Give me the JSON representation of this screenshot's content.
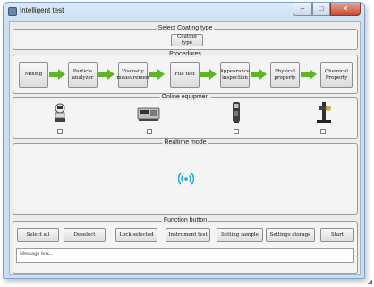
{
  "window": {
    "title": "Intelligent test",
    "controls": {
      "minimize": "‒",
      "maximize": "□",
      "close": "✕"
    }
  },
  "coating": {
    "group_title": "Select Coating type",
    "button": "Coating type"
  },
  "procedures": {
    "group_title": "Procedures",
    "steps": [
      "Mixing",
      "Particle analyzer",
      "Viscosity measuremen",
      "File test",
      "Appearance inspection",
      "Physical property",
      "Chemical Property"
    ]
  },
  "equipment": {
    "group_title": "Online equipmen",
    "items": [
      "robot-device",
      "lab-analyzer",
      "handheld-meter",
      "test-stand"
    ]
  },
  "realtime": {
    "group_title": "Realtime mode"
  },
  "functions": {
    "group_title": "Function button",
    "buttons": [
      "Select all",
      "Deselect",
      "Lock selected",
      "Instrument test",
      "Setting sample",
      "Settings storage",
      "Start"
    ],
    "message": "Message box..."
  },
  "colors": {
    "arrow": "#5fb526",
    "signal": "#1aa8d8"
  }
}
